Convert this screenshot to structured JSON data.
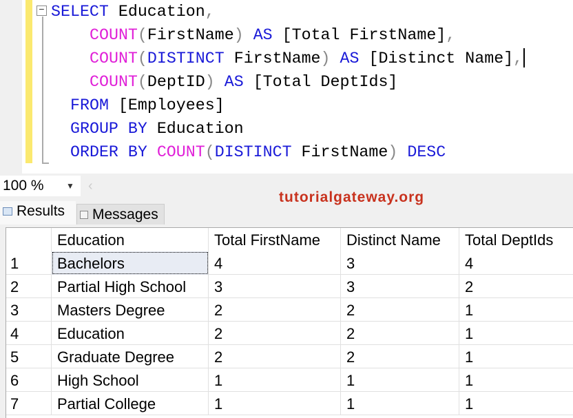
{
  "editor": {
    "lines": [
      [
        {
          "t": "SELECT",
          "c": "kw"
        },
        {
          "t": " Education",
          "c": ""
        },
        {
          "t": ",",
          "c": "pn"
        }
      ],
      [
        {
          "t": "COUNT",
          "c": "fn"
        },
        {
          "t": "(",
          "c": "pn"
        },
        {
          "t": "FirstName",
          "c": ""
        },
        {
          "t": ")",
          "c": "pn"
        },
        {
          "t": " ",
          "c": ""
        },
        {
          "t": "AS",
          "c": "kw"
        },
        {
          "t": " [Total FirstName]",
          "c": ""
        },
        {
          "t": ",",
          "c": "pn"
        }
      ],
      [
        {
          "t": "COUNT",
          "c": "fn"
        },
        {
          "t": "(",
          "c": "pn"
        },
        {
          "t": "DISTINCT",
          "c": "kw"
        },
        {
          "t": " FirstName",
          "c": ""
        },
        {
          "t": ")",
          "c": "pn"
        },
        {
          "t": " ",
          "c": ""
        },
        {
          "t": "AS",
          "c": "kw"
        },
        {
          "t": " [Distinct Name]",
          "c": ""
        },
        {
          "t": ",",
          "c": "pn"
        }
      ],
      [
        {
          "t": "COUNT",
          "c": "fn"
        },
        {
          "t": "(",
          "c": "pn"
        },
        {
          "t": "DeptID",
          "c": ""
        },
        {
          "t": ")",
          "c": "pn"
        },
        {
          "t": " ",
          "c": ""
        },
        {
          "t": "AS",
          "c": "kw"
        },
        {
          "t": " [Total DeptIds]",
          "c": ""
        }
      ],
      [
        {
          "t": "FROM",
          "c": "kw"
        },
        {
          "t": " [Employees]",
          "c": ""
        }
      ],
      [
        {
          "t": "GROUP BY",
          "c": "kw"
        },
        {
          "t": " Education",
          "c": ""
        }
      ],
      [
        {
          "t": "ORDER BY",
          "c": "kw"
        },
        {
          "t": " ",
          "c": ""
        },
        {
          "t": "COUNT",
          "c": "fn"
        },
        {
          "t": "(",
          "c": "pn"
        },
        {
          "t": "DISTINCT",
          "c": "kw"
        },
        {
          "t": " FirstName",
          "c": ""
        },
        {
          "t": ")",
          "c": "pn"
        },
        {
          "t": " ",
          "c": ""
        },
        {
          "t": "DESC",
          "c": "kw"
        }
      ]
    ]
  },
  "toolbar": {
    "zoom": "100 %"
  },
  "watermark": "tutorialgateway.org",
  "tabs": {
    "results": "Results",
    "messages": "Messages"
  },
  "grid": {
    "columns": [
      "",
      "Education",
      "Total FirstName",
      "Distinct Name",
      "Total DeptIds"
    ],
    "rows": [
      [
        "1",
        "Bachelors",
        "4",
        "3",
        "4"
      ],
      [
        "2",
        "Partial High School",
        "3",
        "3",
        "2"
      ],
      [
        "3",
        "Masters Degree",
        "2",
        "2",
        "1"
      ],
      [
        "4",
        "Education",
        "2",
        "2",
        "1"
      ],
      [
        "5",
        "Graduate Degree",
        "2",
        "2",
        "1"
      ],
      [
        "6",
        "High School",
        "1",
        "1",
        "1"
      ],
      [
        "7",
        "Partial College",
        "1",
        "1",
        "1"
      ]
    ]
  }
}
